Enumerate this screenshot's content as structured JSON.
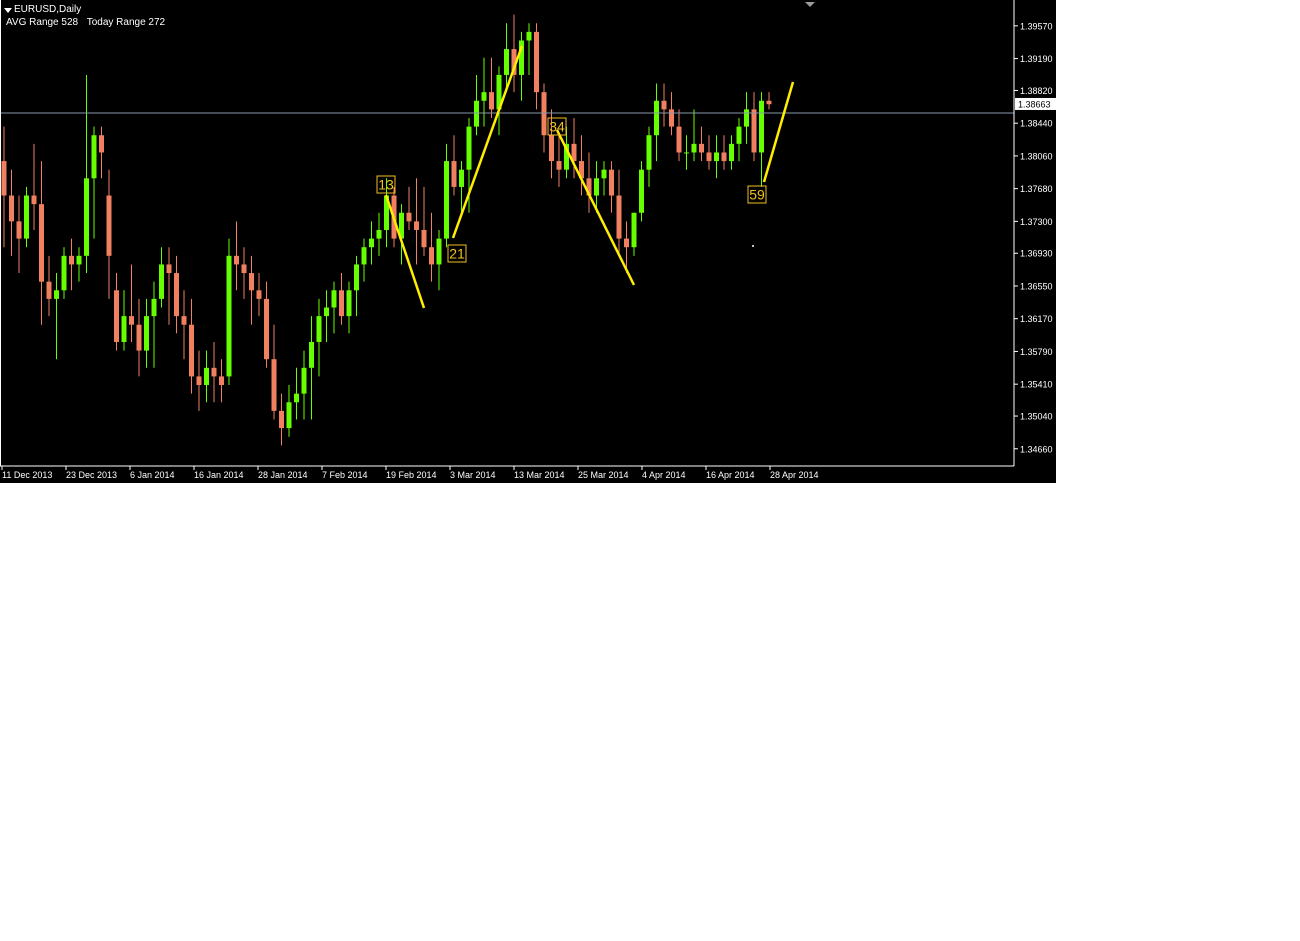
{
  "header": {
    "symbol_label": "EURUSD,Daily",
    "avg_range_label": "AVG Range 528",
    "today_range_label": "Today Range 272"
  },
  "colors": {
    "background": "#000000",
    "bull": "#66ff00",
    "bear": "#f08060",
    "wave_line": "#ffee00",
    "wave_label": "#f0c020",
    "axis": "#ffffff",
    "bid_line": "#8899aa"
  },
  "chart_data": {
    "type": "candlestick",
    "symbol": "EURUSD",
    "timeframe": "Daily",
    "ylim": [
      1.3446,
      1.3987
    ],
    "y_ticks": [
      "1.39570",
      "1.39190",
      "1.38820",
      "1.38440",
      "1.38060",
      "1.37680",
      "1.37300",
      "1.36930",
      "1.36550",
      "1.36170",
      "1.35790",
      "1.35410",
      "1.35040",
      "1.34660"
    ],
    "current_price": "1.38663",
    "x_labels": [
      "11 Dec 2013",
      "23 Dec 2013",
      "6 Jan 2014",
      "16 Jan 2014",
      "28 Jan 2014",
      "7 Feb 2014",
      "19 Feb 2014",
      "3 Mar 2014",
      "13 Mar 2014",
      "25 Mar 2014",
      "4 Apr 2014",
      "16 Apr 2014",
      "28 Apr 2014"
    ],
    "candles": [
      [
        1.38,
        1.384,
        1.37,
        1.376
      ],
      [
        1.376,
        1.379,
        1.369,
        1.373
      ],
      [
        1.373,
        1.376,
        1.367,
        1.371
      ],
      [
        1.371,
        1.377,
        1.37,
        1.376
      ],
      [
        1.376,
        1.382,
        1.372,
        1.375
      ],
      [
        1.375,
        1.38,
        1.361,
        1.366
      ],
      [
        1.366,
        1.369,
        1.362,
        1.364
      ],
      [
        1.364,
        1.367,
        1.357,
        1.365
      ],
      [
        1.365,
        1.37,
        1.364,
        1.369
      ],
      [
        1.369,
        1.371,
        1.365,
        1.368
      ],
      [
        1.368,
        1.37,
        1.366,
        1.369
      ],
      [
        1.369,
        1.39,
        1.367,
        1.378
      ],
      [
        1.378,
        1.384,
        1.371,
        1.383
      ],
      [
        1.383,
        1.384,
        1.378,
        1.381
      ],
      [
        1.376,
        1.379,
        1.364,
        1.369
      ],
      [
        1.365,
        1.367,
        1.358,
        1.359
      ],
      [
        1.359,
        1.365,
        1.358,
        1.362
      ],
      [
        1.362,
        1.368,
        1.359,
        1.361
      ],
      [
        1.361,
        1.364,
        1.355,
        1.358
      ],
      [
        1.358,
        1.364,
        1.356,
        1.362
      ],
      [
        1.362,
        1.366,
        1.356,
        1.364
      ],
      [
        1.364,
        1.37,
        1.363,
        1.368
      ],
      [
        1.368,
        1.37,
        1.361,
        1.367
      ],
      [
        1.367,
        1.369,
        1.36,
        1.362
      ],
      [
        1.362,
        1.365,
        1.357,
        1.361
      ],
      [
        1.361,
        1.364,
        1.353,
        1.355
      ],
      [
        1.355,
        1.358,
        1.351,
        1.354
      ],
      [
        1.354,
        1.358,
        1.352,
        1.356
      ],
      [
        1.356,
        1.359,
        1.352,
        1.355
      ],
      [
        1.355,
        1.357,
        1.352,
        1.354
      ],
      [
        1.355,
        1.371,
        1.354,
        1.369
      ],
      [
        1.369,
        1.373,
        1.365,
        1.368
      ],
      [
        1.368,
        1.37,
        1.364,
        1.367
      ],
      [
        1.367,
        1.369,
        1.361,
        1.365
      ],
      [
        1.365,
        1.367,
        1.362,
        1.364
      ],
      [
        1.364,
        1.366,
        1.356,
        1.357
      ],
      [
        1.357,
        1.361,
        1.35,
        1.351
      ],
      [
        1.351,
        1.353,
        1.347,
        1.349
      ],
      [
        1.349,
        1.354,
        1.348,
        1.352
      ],
      [
        1.352,
        1.356,
        1.35,
        1.353
      ],
      [
        1.353,
        1.358,
        1.35,
        1.356
      ],
      [
        1.356,
        1.362,
        1.35,
        1.359
      ],
      [
        1.359,
        1.364,
        1.355,
        1.362
      ],
      [
        1.362,
        1.365,
        1.359,
        1.363
      ],
      [
        1.363,
        1.366,
        1.36,
        1.365
      ],
      [
        1.365,
        1.367,
        1.361,
        1.362
      ],
      [
        1.362,
        1.366,
        1.36,
        1.365
      ],
      [
        1.365,
        1.369,
        1.362,
        1.368
      ],
      [
        1.368,
        1.371,
        1.366,
        1.37
      ],
      [
        1.37,
        1.373,
        1.368,
        1.371
      ],
      [
        1.371,
        1.374,
        1.369,
        1.372
      ],
      [
        1.372,
        1.378,
        1.37,
        1.376
      ],
      [
        1.376,
        1.377,
        1.37,
        1.371
      ],
      [
        1.371,
        1.375,
        1.368,
        1.374
      ],
      [
        1.374,
        1.377,
        1.372,
        1.373
      ],
      [
        1.373,
        1.378,
        1.368,
        1.372
      ],
      [
        1.372,
        1.377,
        1.369,
        1.37
      ],
      [
        1.37,
        1.374,
        1.366,
        1.368
      ],
      [
        1.368,
        1.372,
        1.365,
        1.371
      ],
      [
        1.371,
        1.382,
        1.37,
        1.38
      ],
      [
        1.38,
        1.383,
        1.376,
        1.377
      ],
      [
        1.377,
        1.38,
        1.374,
        1.379
      ],
      [
        1.379,
        1.385,
        1.374,
        1.384
      ],
      [
        1.384,
        1.39,
        1.383,
        1.387
      ],
      [
        1.387,
        1.392,
        1.384,
        1.388
      ],
      [
        1.388,
        1.392,
        1.385,
        1.386
      ],
      [
        1.386,
        1.391,
        1.383,
        1.39
      ],
      [
        1.39,
        1.396,
        1.388,
        1.393
      ],
      [
        1.393,
        1.397,
        1.388,
        1.39
      ],
      [
        1.39,
        1.395,
        1.387,
        1.394
      ],
      [
        1.394,
        1.396,
        1.39,
        1.395
      ],
      [
        1.395,
        1.396,
        1.386,
        1.388
      ],
      [
        1.388,
        1.389,
        1.381,
        1.383
      ],
      [
        1.383,
        1.386,
        1.378,
        1.38
      ],
      [
        1.38,
        1.383,
        1.377,
        1.379
      ],
      [
        1.379,
        1.384,
        1.378,
        1.382
      ],
      [
        1.382,
        1.385,
        1.378,
        1.38
      ],
      [
        1.38,
        1.383,
        1.376,
        1.378
      ],
      [
        1.378,
        1.381,
        1.374,
        1.376
      ],
      [
        1.376,
        1.38,
        1.374,
        1.378
      ],
      [
        1.378,
        1.38,
        1.376,
        1.379
      ],
      [
        1.379,
        1.38,
        1.374,
        1.376
      ],
      [
        1.376,
        1.379,
        1.369,
        1.371
      ],
      [
        1.371,
        1.373,
        1.367,
        1.37
      ],
      [
        1.37,
        1.374,
        1.369,
        1.374
      ],
      [
        1.374,
        1.38,
        1.373,
        1.379
      ],
      [
        1.379,
        1.384,
        1.377,
        1.383
      ],
      [
        1.383,
        1.389,
        1.38,
        1.387
      ],
      [
        1.387,
        1.389,
        1.384,
        1.386
      ],
      [
        1.386,
        1.388,
        1.383,
        1.384
      ],
      [
        1.384,
        1.386,
        1.38,
        1.381
      ],
      [
        1.381,
        1.383,
        1.379,
        1.381
      ],
      [
        1.381,
        1.386,
        1.38,
        1.382
      ],
      [
        1.382,
        1.384,
        1.38,
        1.381
      ],
      [
        1.381,
        1.383,
        1.379,
        1.38
      ],
      [
        1.38,
        1.383,
        1.378,
        1.381
      ],
      [
        1.381,
        1.383,
        1.379,
        1.38
      ],
      [
        1.38,
        1.383,
        1.379,
        1.382
      ],
      [
        1.382,
        1.385,
        1.38,
        1.384
      ],
      [
        1.384,
        1.388,
        1.382,
        1.386
      ],
      [
        1.386,
        1.388,
        1.38,
        1.381
      ],
      [
        1.381,
        1.388,
        1.377,
        1.387
      ],
      [
        1.387,
        1.388,
        1.386,
        1.3866
      ]
    ],
    "wave_labels": [
      "13",
      "21",
      "34",
      "59"
    ]
  }
}
